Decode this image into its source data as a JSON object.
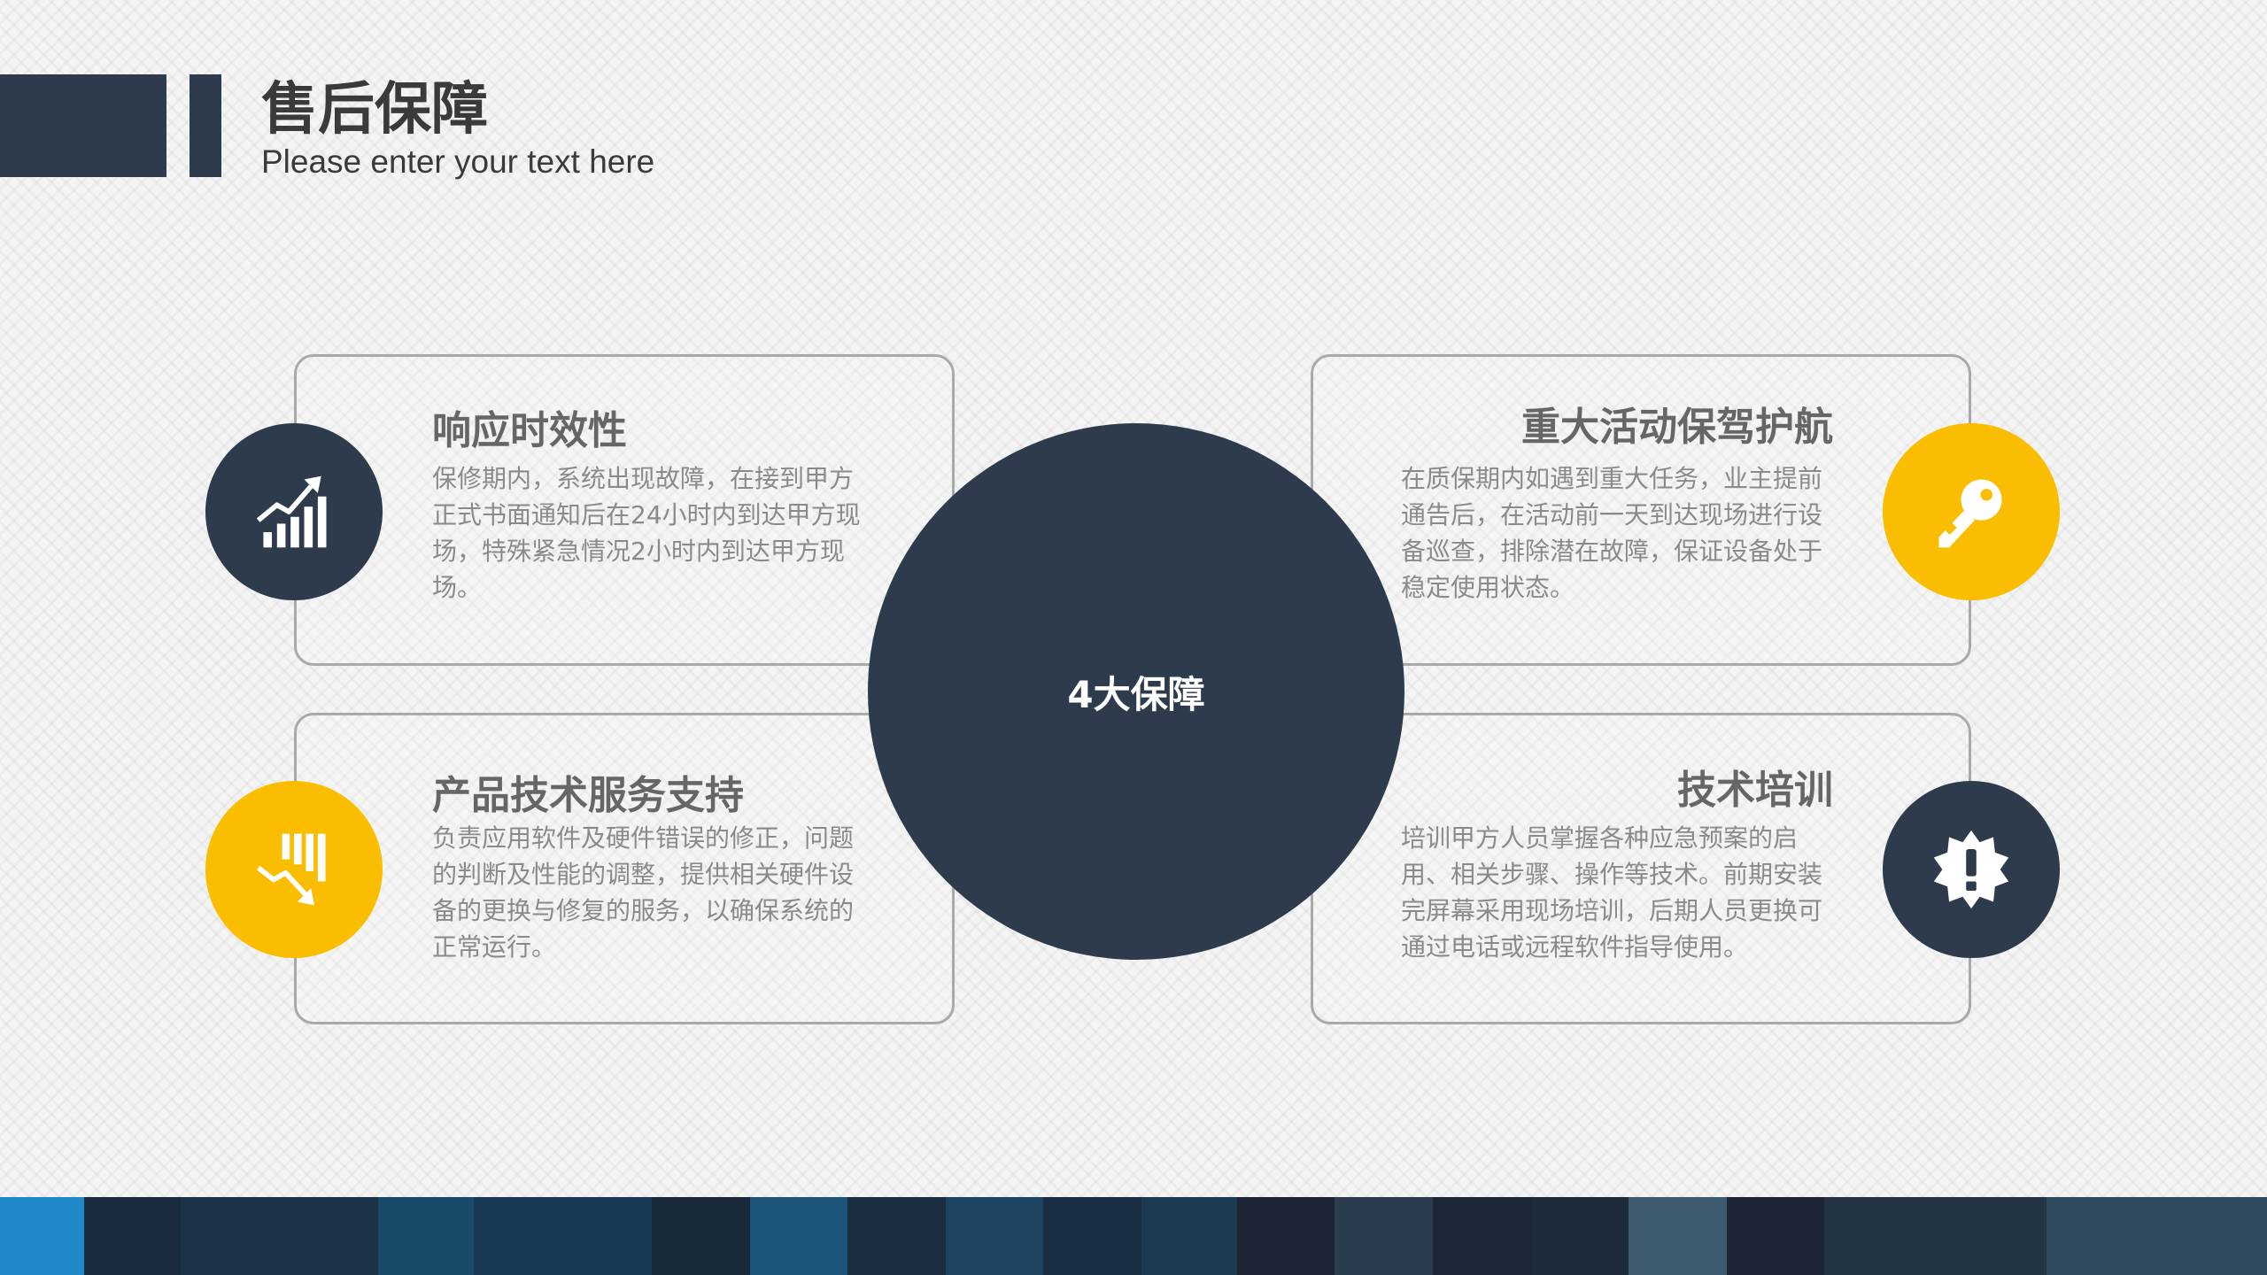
{
  "header": {
    "title": "售后保障",
    "subtitle": "Please enter your text here"
  },
  "center": {
    "label": "4大保障"
  },
  "items": [
    {
      "title": "响应时效性",
      "text": "保修期内，系统出现故障，在接到甲方正式书面通知后在24小时内到达甲方现场，特殊紧急情况2小时内到达甲方现场。",
      "icon": "growth-chart-icon",
      "icon_color": "#2e3b4c"
    },
    {
      "title": "重大活动保驾护航",
      "text": "在质保期内如遇到重大任务，业主提前通告后，在活动前一天到达现场进行设备巡查，排除潜在故障，保证设备处于稳定使用状态。",
      "icon": "key-icon",
      "icon_color": "#fbbd00"
    },
    {
      "title": "产品技术服务支持",
      "text": "负责应用软件及硬件错误的修正，问题的判断及性能的调整，提供相关硬件设备的更换与修复的服务，以确保系统的正常运行。",
      "icon": "declining-chart-icon",
      "icon_color": "#fbbd00"
    },
    {
      "title": "技术培训",
      "text": "培训甲方人员掌握各种应急预案的启用、相关步骤、操作等技术。前期安装完屏幕采用现场培训，后期人员更换可通过电话或远程软件指导使用。",
      "icon": "alert-badge-icon",
      "icon_color": "#2e3b4c"
    }
  ],
  "colors": {
    "dark": "#2e3b4c",
    "accent": "#fbbd00",
    "footer_strip": [
      "#1f88c8",
      "#1a2c3d",
      "#1c3247",
      "#1a4a6a",
      "#193a55",
      "#1a2a3a",
      "#1c5578",
      "#1b2d40",
      "#1d4460",
      "#1a2f44",
      "#1c3b52",
      "#1b2433",
      "#2a3c4e",
      "#1c2838",
      "#1e2b3a",
      "#3d5a6e",
      "#1d2635",
      "#243444",
      "#2f4a5c"
    ]
  }
}
